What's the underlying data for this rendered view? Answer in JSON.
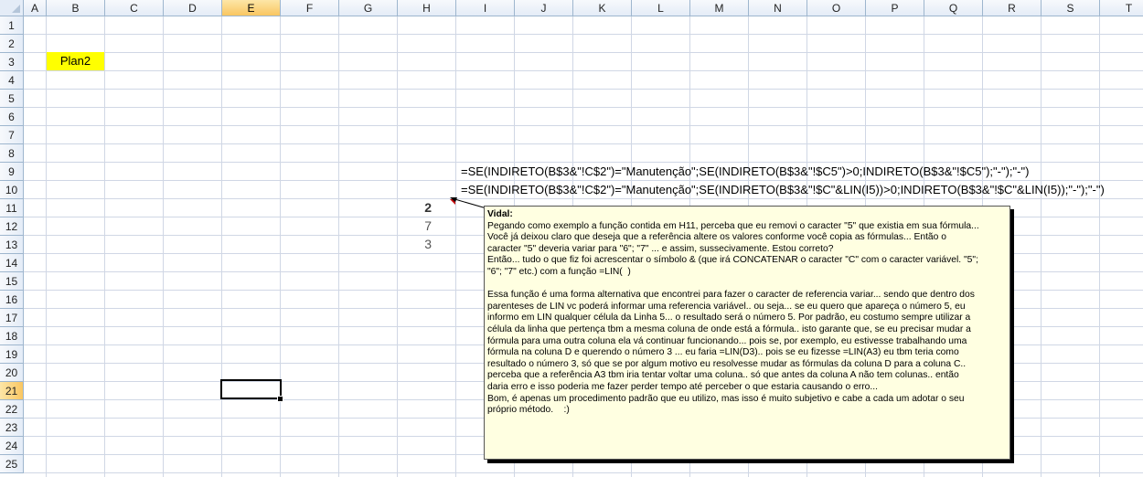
{
  "columns": [
    "A",
    "B",
    "C",
    "D",
    "E",
    "F",
    "G",
    "H",
    "I",
    "J",
    "K",
    "L",
    "M",
    "N",
    "O",
    "P",
    "Q",
    "R",
    "S",
    "T"
  ],
  "rows": [
    "1",
    "2",
    "3",
    "4",
    "5",
    "6",
    "7",
    "8",
    "9",
    "10",
    "11",
    "12",
    "13",
    "14",
    "15",
    "16",
    "17",
    "18",
    "19",
    "20",
    "21",
    "22",
    "23",
    "24",
    "25"
  ],
  "cells": {
    "B3": "Plan2",
    "I9": "=SE(INDIRETO(B$3&\"!C$2\")=\"Manutenção\";SE(INDIRETO(B$3&\"!$C5\")>0;INDIRETO(B$3&\"!$C5\");\"-\");\"-\")",
    "I10": "=SE(INDIRETO(B$3&\"!C$2\")=\"Manutenção\";SE(INDIRETO(B$3&\"!$C\"&LIN(I5))>0;INDIRETO(B$3&\"!$C\"&LIN(I5));\"-\");\"-\")",
    "H11": "2",
    "H12": "7",
    "H13": "3"
  },
  "colors": {
    "highlight": "#ffff00",
    "comment_bg": "#ffffe1",
    "selected_header": "#f9c661"
  },
  "comment": {
    "author": "Vidal:",
    "lines": [
      "Pegando como exemplo a função contida em H11, perceba que eu removi o caracter \"5\" que existia em sua fórmula...",
      "Você já deixou claro que deseja que a referência altere os valores conforme você copia as fórmulas... Então o",
      "caracter \"5\" deveria variar para \"6\"; \"7\" ... e assim, sussecivamente. Estou correto?",
      "Então... tudo o que fiz foi acrescentar o símbolo & (que irá CONCATENAR o caracter \"C\" com o caracter variável. \"5\";",
      "\"6\"; \"7\" etc.) com a função =LIN(  )",
      "",
      "Essa função é uma forma alternativa que encontrei para fazer o caracter de referencia variar... sendo que dentro dos",
      "parenteses de LIN vc poderá informar uma referencia variável.. ou seja... se eu quero que apareça o número 5, eu",
      "informo em LIN qualquer célula da Linha 5... o resultado será o número 5. Por padrão, eu costumo sempre utilizar a",
      "célula da linha que pertença tbm a mesma coluna de onde está a fórmula.. isto garante que, se eu precisar mudar a",
      "fórmula para uma outra coluna ela vá continuar funcionando... pois se, por exemplo, eu estivesse trabalhando uma",
      "fórmula na coluna D e querendo o número 3 ... eu faria =LIN(D3).. pois se eu fizesse =LIN(A3) eu tbm teria como",
      "resultado o número 3, só que se por algum motivo eu resolvesse mudar as fórmulas da coluna D para a coluna C..",
      "perceba que a referência A3 tbm iria tentar voltar uma coluna.. só que antes da coluna A não tem colunas.. então",
      "daria erro e isso poderia me fazer perder tempo até perceber o que estaria causando o erro...",
      "Bom, é apenas um procedimento padrão que eu utilizo, mas isso é muito subjetivo e cabe a cada um adotar o seu",
      "próprio método.    :)"
    ]
  }
}
